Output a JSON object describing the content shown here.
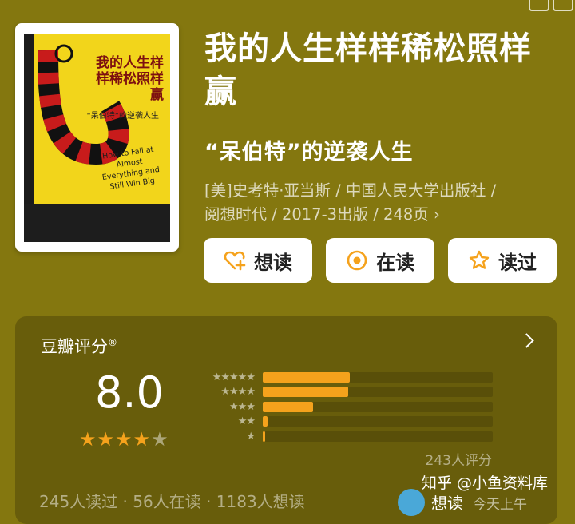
{
  "book": {
    "title": "我的人生样样稀松照样赢",
    "subtitle": "“呆伯特”的逆袭人生",
    "meta_line1": "[美]史考特·亚当斯 / 中国人民大学出版社 /",
    "meta_line2": "阅想时代 / 2017-3出版 / 248页",
    "meta_chevron": "›"
  },
  "cover": {
    "title": "我的人生样样稀松照样赢",
    "sub": "“呆伯特”的逆袭人生",
    "english": "How to Fail at Almost Everything and Still Win Big"
  },
  "actions": {
    "want": "想读",
    "reading": "在读",
    "read": "读过"
  },
  "rating": {
    "label": "豆瓣评分",
    "trademark": "®",
    "score": "8.0",
    "stars_filled": 4,
    "stars_total": 5,
    "rating_count": "243人评分",
    "distribution": [
      {
        "stars": "★★★★★",
        "percent": 38
      },
      {
        "stars": "★★★★",
        "percent": 37
      },
      {
        "stars": "★★★",
        "percent": 22
      },
      {
        "stars": "★★",
        "percent": 2
      },
      {
        "stars": "★",
        "percent": 1
      }
    ],
    "counts_text": "245人读过 · 56人在读 · 1183人想读"
  },
  "footer": {
    "watermark": "知乎 @小鱼资料库",
    "partial_status": "想读",
    "partial_time": "今天上午"
  },
  "colors": {
    "background": "#84770f",
    "bar": "#f5a21c",
    "star": "#f5a21c"
  }
}
